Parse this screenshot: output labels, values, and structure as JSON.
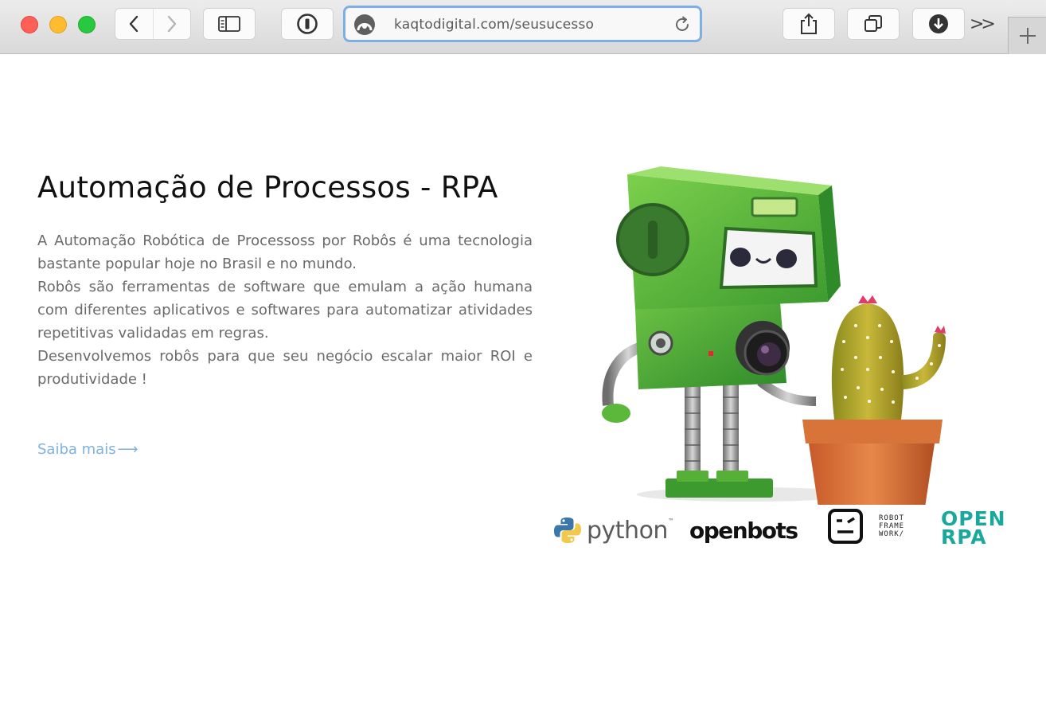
{
  "browser": {
    "url": "kaqtodigital.com/seusucesso",
    "overflow_label": ">>",
    "icons": {
      "back": "chevron-left-icon",
      "forward": "chevron-right-icon",
      "sidebar": "sidebar-icon",
      "password": "password-manager-icon",
      "reload": "reload-icon",
      "share": "share-icon",
      "tabs": "tab-overview-icon",
      "downloads": "download-icon",
      "new_tab": "plus-icon"
    },
    "accent_color": "#7eaee3"
  },
  "content": {
    "title": "Automação de Processos - RPA",
    "paragraphs": [
      "A Automação Robótica de Processoss por Robôs é uma tecnologia bastante popular hoje no Brasil e no mundo.",
      "Robôs são ferramentas de software que emulam a ação humana com diferentes aplicativos e softwares para automatizar atividades repetitivas validadas em regras.",
      "Desenvolvemos robôs para que seu negócio escalar maior ROI e produtividade !"
    ],
    "cta_label": "Saiba mais",
    "cta_arrow": "⟶",
    "cta_color": "#7fb2de"
  },
  "logos": {
    "python": {
      "word": "python",
      "tm": "™"
    },
    "openbots": "openbots",
    "robot_framework": [
      "ROBOT",
      "FRAME",
      "WORK/"
    ],
    "openrpa": [
      "OPEN",
      "RPA"
    ],
    "openrpa_color": "#1aa89d"
  }
}
